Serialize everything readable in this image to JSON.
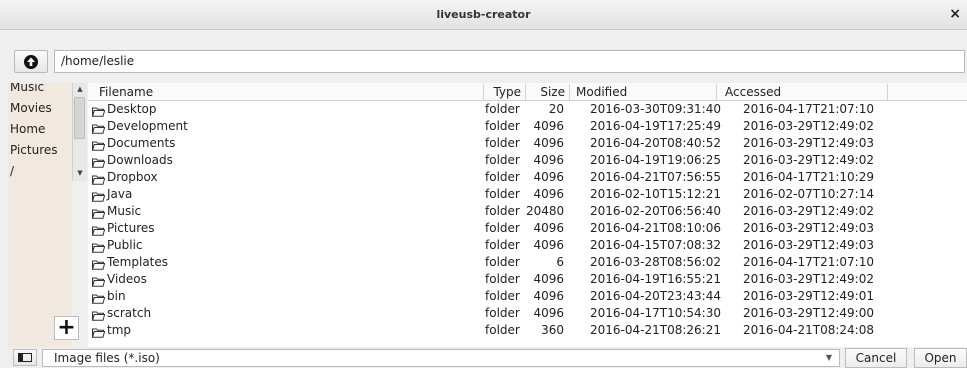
{
  "window": {
    "title": "liveusb-creator",
    "close_label": "×"
  },
  "path": {
    "value": "/home/leslie"
  },
  "sidebar": {
    "items": [
      {
        "label": "Music"
      },
      {
        "label": "Movies"
      },
      {
        "label": "Home"
      },
      {
        "label": "Pictures"
      },
      {
        "label": "/"
      }
    ]
  },
  "table": {
    "columns": [
      "Filename",
      "Type",
      "Size",
      "Modified",
      "Accessed"
    ],
    "rows": [
      {
        "name": "Desktop",
        "type": "folder",
        "size": "20",
        "modified": "2016-03-30T09:31:40",
        "accessed": "2016-04-17T21:07:10"
      },
      {
        "name": "Development",
        "type": "folder",
        "size": "4096",
        "modified": "2016-04-19T17:25:49",
        "accessed": "2016-03-29T12:49:02"
      },
      {
        "name": "Documents",
        "type": "folder",
        "size": "4096",
        "modified": "2016-04-20T08:40:52",
        "accessed": "2016-03-29T12:49:03"
      },
      {
        "name": "Downloads",
        "type": "folder",
        "size": "4096",
        "modified": "2016-04-19T19:06:25",
        "accessed": "2016-03-29T12:49:02"
      },
      {
        "name": "Dropbox",
        "type": "folder",
        "size": "4096",
        "modified": "2016-04-21T07:56:55",
        "accessed": "2016-04-17T21:10:29"
      },
      {
        "name": "Java",
        "type": "folder",
        "size": "4096",
        "modified": "2016-02-10T15:12:21",
        "accessed": "2016-02-07T10:27:14"
      },
      {
        "name": "Music",
        "type": "folder",
        "size": "20480",
        "modified": "2016-02-20T06:56:40",
        "accessed": "2016-03-29T12:49:02"
      },
      {
        "name": "Pictures",
        "type": "folder",
        "size": "4096",
        "modified": "2016-04-21T08:10:06",
        "accessed": "2016-03-29T12:49:03"
      },
      {
        "name": "Public",
        "type": "folder",
        "size": "4096",
        "modified": "2016-04-15T07:08:32",
        "accessed": "2016-03-29T12:49:03"
      },
      {
        "name": "Templates",
        "type": "folder",
        "size": "6",
        "modified": "2016-03-28T08:56:02",
        "accessed": "2016-04-17T21:07:10"
      },
      {
        "name": "Videos",
        "type": "folder",
        "size": "4096",
        "modified": "2016-04-19T16:55:21",
        "accessed": "2016-03-29T12:49:02"
      },
      {
        "name": "bin",
        "type": "folder",
        "size": "4096",
        "modified": "2016-04-20T23:43:44",
        "accessed": "2016-03-29T12:49:01"
      },
      {
        "name": "scratch",
        "type": "folder",
        "size": "4096",
        "modified": "2016-04-17T10:54:30",
        "accessed": "2016-03-29T12:49:00"
      },
      {
        "name": "tmp",
        "type": "folder",
        "size": "360",
        "modified": "2016-04-21T08:26:21",
        "accessed": "2016-04-21T08:24:08"
      }
    ]
  },
  "footer": {
    "filter_label": "Image files (*.iso)",
    "cancel_label": "Cancel",
    "open_label": "Open"
  },
  "icons": {
    "up": "up-arrow-icon",
    "folder": "folder-open-icon",
    "add": "plus-icon",
    "sidebar_toggle": "sidebar-toggle-icon",
    "dropdown": "chevron-down-icon"
  }
}
